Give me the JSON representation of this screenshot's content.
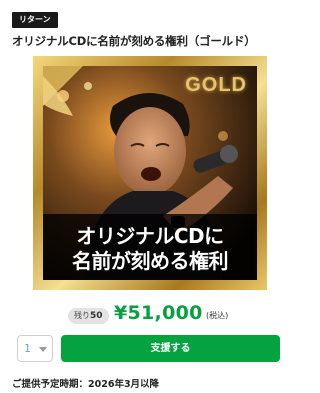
{
  "return_tag": "リターン",
  "title": "オリジナルCDに名前が刻める権利（ゴールド）",
  "hero": {
    "badge": "GOLD",
    "caption_line1": "オリジナルCDに",
    "caption_line2": "名前が刻める権利"
  },
  "stock": {
    "label": "残り",
    "count": "50"
  },
  "price": "¥51,000",
  "tax_note": "(税込)",
  "quantity": {
    "selected": "1"
  },
  "support_button": "支援する",
  "delivery": "ご提供予定時期：2026年3月以降",
  "colors": {
    "accent_green": "#04a33f",
    "price_green": "#06a040",
    "gold": "#e8c466"
  }
}
